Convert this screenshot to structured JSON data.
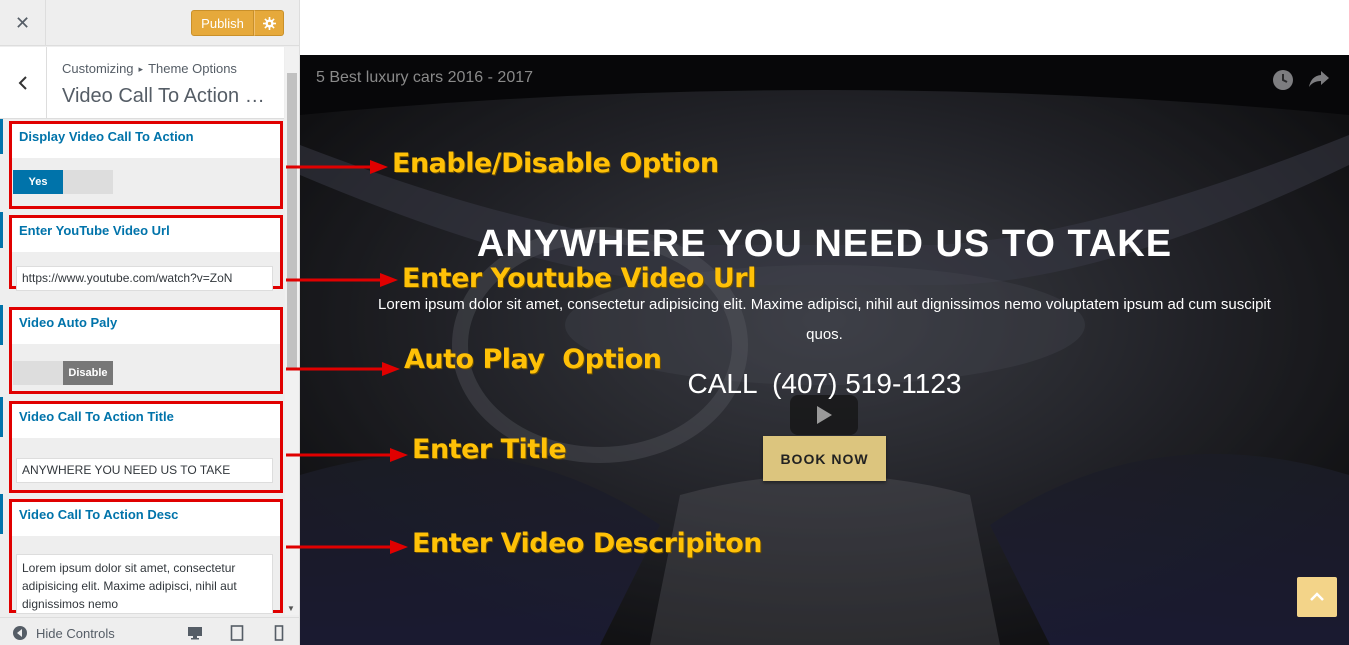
{
  "customizer": {
    "close_symbol": "✕",
    "publish_label": "Publish",
    "breadcrumb": {
      "root": "Customizing",
      "separator": "▸",
      "parent": "Theme Options"
    },
    "section_title": "Video Call To Action Se…",
    "controls": {
      "display_video": {
        "label": "Display Video Call To Action",
        "value": "Yes"
      },
      "youtube_url": {
        "label": "Enter YouTube Video Url",
        "value": "https://www.youtube.com/watch?v=ZoN"
      },
      "auto_play": {
        "label": "Video Auto Paly",
        "value": "Disable"
      },
      "cta_title": {
        "label": "Video Call To Action Title",
        "value": "ANYWHERE YOU NEED US TO TAKE"
      },
      "cta_desc": {
        "label": "Video Call To Action Desc",
        "value": "Lorem ipsum dolor sit amet, consectetur adipisicing elit. Maxime adipisci, nihil aut dignissimos nemo"
      }
    },
    "footer": {
      "hide_controls_label": "Hide Controls"
    }
  },
  "preview": {
    "video_title": "5 Best luxury cars 2016 - 2017",
    "hero_title": "ANYWHERE YOU NEED US TO TAKE",
    "hero_desc": "Lorem ipsum dolor sit amet, consectetur adipisicing elit. Maxime adipisci, nihil aut dignissimos nemo voluptatem ipsum ad cum suscipit quos.",
    "call_text": "CALL  (407) 519-1123",
    "book_label": "BOOK NOW"
  },
  "annotations": {
    "enable_disable": "Enable/Disable Option",
    "youtube_url": "Enter Youtube Video Url",
    "auto_play": "Auto Play  Option",
    "title": "Enter Title",
    "description": "Enter Video Descripiton"
  },
  "colors": {
    "accent_blue": "#0073aa",
    "publish": "#e6a93b",
    "highlight_red": "#e00000",
    "annotation_yellow": "#ffc107",
    "book_button": "#dcc57e"
  }
}
